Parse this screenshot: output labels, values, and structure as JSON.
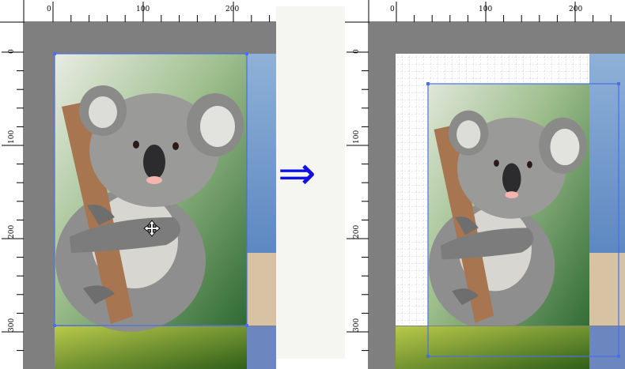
{
  "rulers": {
    "horizontal_labels": [
      "0",
      "100",
      "200"
    ],
    "vertical_labels": [
      "0",
      "100",
      "200",
      "300"
    ]
  },
  "transition_arrow": {
    "symbol": "⇒",
    "color": "#1010e0"
  },
  "colors": {
    "workspace": "#7f7f7f",
    "selection": "#4a6fe8",
    "grid_background": "#ffffff",
    "grid_lines": "#c8c8c8"
  },
  "icons": [
    "move-cursor-icon",
    "selection-handle"
  ]
}
